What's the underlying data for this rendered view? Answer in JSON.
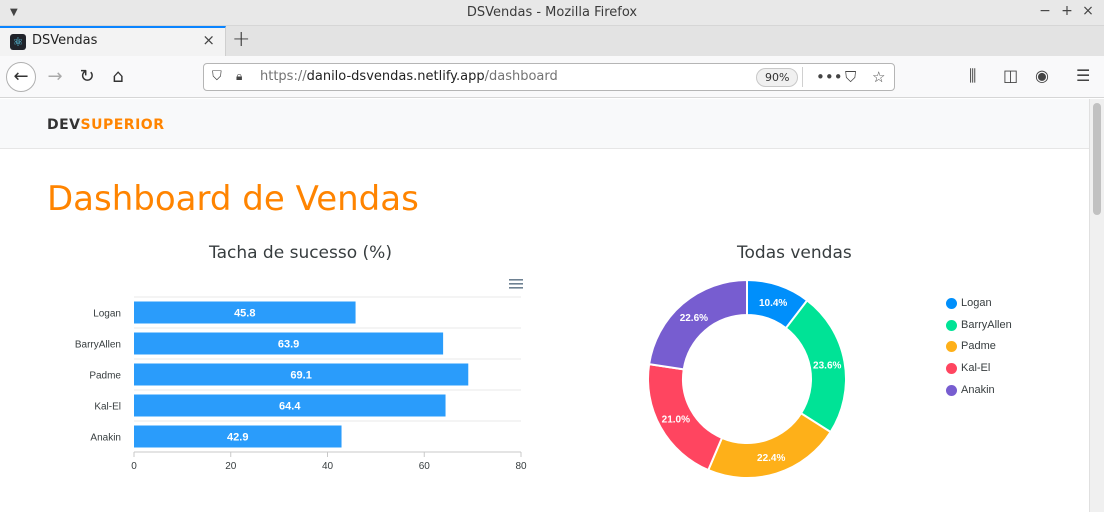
{
  "window": {
    "title": "DSVendas - Mozilla Firefox"
  },
  "tabs": [
    {
      "label": "DSVendas"
    }
  ],
  "urlbar": {
    "url_prefix": "https://",
    "url_domain": "danilo-dsvendas.netlify.app",
    "url_path": "/dashboard",
    "zoom": "90%"
  },
  "site": {
    "logo_dev": "DEV",
    "logo_superior": "SUPERIOR",
    "page_title": "Dashboard de Vendas"
  },
  "colors": {
    "accent": "#ff8400",
    "bar": "#2a9cfb",
    "logan": "#008ffb",
    "barryallen": "#00e396",
    "padme": "#feb019",
    "kalel": "#ff4560",
    "anakin": "#775dd0"
  },
  "chart_data": [
    {
      "type": "bar",
      "orientation": "horizontal",
      "title": "Tacha de sucesso (%)",
      "categories": [
        "Logan",
        "BarryAllen",
        "Padme",
        "Kal-El",
        "Anakin"
      ],
      "values": [
        45.8,
        63.9,
        69.1,
        64.4,
        42.9
      ],
      "xlim": [
        0,
        80
      ],
      "xticks": [
        0,
        20,
        40,
        60,
        80
      ],
      "grid": true
    },
    {
      "type": "pie",
      "variant": "donut",
      "title": "Todas vendas",
      "categories": [
        "Logan",
        "BarryAllen",
        "Padme",
        "Kal-El",
        "Anakin"
      ],
      "values": [
        10.4,
        23.6,
        22.4,
        21.0,
        22.6
      ],
      "labels": [
        "10.4%",
        "23.6%",
        "22.4%",
        "21.0%",
        "22.6%"
      ],
      "legend": "right"
    }
  ]
}
